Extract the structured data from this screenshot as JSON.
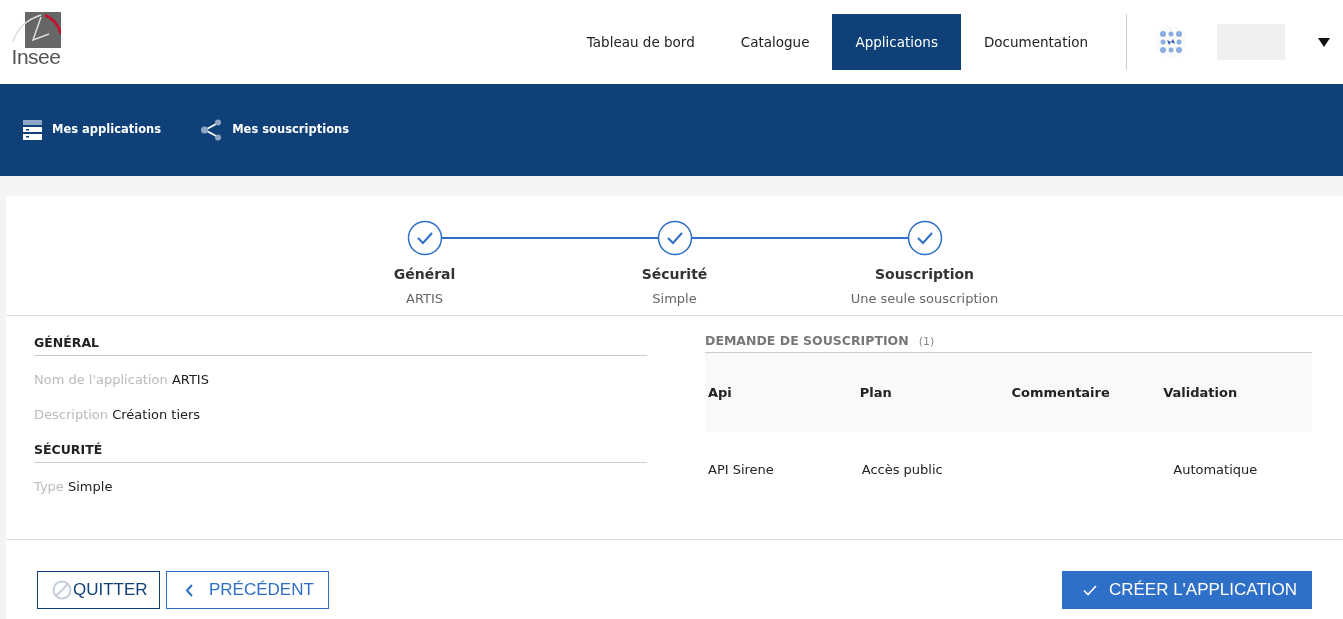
{
  "header": {
    "logo_text": "Insee",
    "nav": [
      {
        "label": "Tableau de bord",
        "selected": false
      },
      {
        "label": "Catalogue",
        "selected": false
      },
      {
        "label": "Applications",
        "selected": true
      },
      {
        "label": "Documentation",
        "selected": false
      }
    ]
  },
  "subnav": [
    {
      "label": "Mes applications",
      "kind": "server"
    },
    {
      "label": "Mes souscriptions",
      "kind": "share"
    }
  ],
  "steps": [
    {
      "title": "Général",
      "subtitle": "ARTIS",
      "done": true
    },
    {
      "title": "Sécurité",
      "subtitle": "Simple",
      "done": true
    },
    {
      "title": "Souscription",
      "subtitle": "Une seule souscription",
      "done": true
    }
  ],
  "sections": [
    {
      "title": "GÉNÉRAL",
      "fields": [
        {
          "label": "Nom de l'application",
          "value": "ARTIS"
        },
        {
          "label": "Description",
          "value": "Création tiers"
        }
      ]
    },
    {
      "title": "SÉCURITÉ",
      "fields": [
        {
          "label": "Type",
          "value": "Simple"
        }
      ]
    }
  ],
  "subscriptions": {
    "title": "DEMANDE DE SOUSCRIPTION",
    "count": "(1)",
    "columns": [
      "Api",
      "Plan",
      "Commentaire",
      "Validation"
    ],
    "rows": [
      [
        "API Sirene",
        "Accès public",
        "",
        "Automatique"
      ]
    ]
  },
  "buttons": [
    {
      "label": "QUITTER",
      "kind": "quit"
    },
    {
      "label": "PRÉCÉDENT",
      "kind": "back"
    },
    {
      "label": "CRÉER L'APPLICATION",
      "kind": "create"
    }
  ]
}
